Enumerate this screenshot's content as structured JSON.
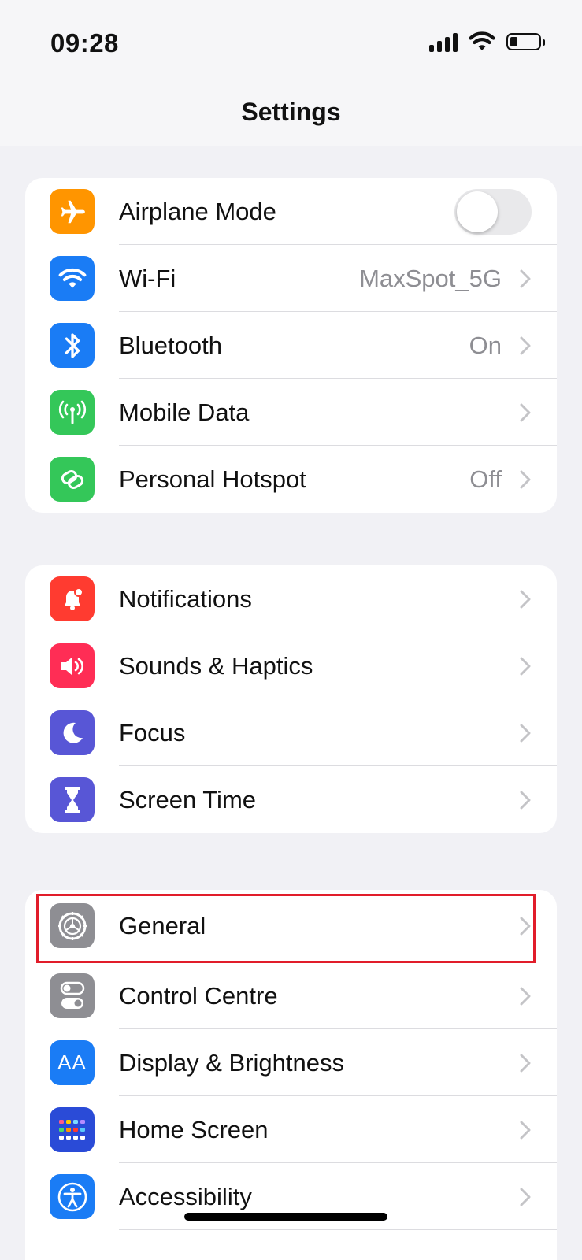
{
  "status_bar": {
    "time": "09:28"
  },
  "nav": {
    "title": "Settings"
  },
  "group1": [
    {
      "label": "Airplane Mode",
      "value": "",
      "icon": "airplane-icon",
      "color": "#ff9500"
    },
    {
      "label": "Wi-Fi",
      "value": "MaxSpot_5G",
      "icon": "wifi-icon",
      "color": "#1a7cf5"
    },
    {
      "label": "Bluetooth",
      "value": "On",
      "icon": "bluetooth-icon",
      "color": "#1a7cf5"
    },
    {
      "label": "Mobile Data",
      "value": "",
      "icon": "antenna-icon",
      "color": "#34c759"
    },
    {
      "label": "Personal Hotspot",
      "value": "Off",
      "icon": "hotspot-icon",
      "color": "#34c759"
    }
  ],
  "group2": [
    {
      "label": "Notifications",
      "icon": "bell-icon",
      "color": "#ff3b30"
    },
    {
      "label": "Sounds & Haptics",
      "icon": "speaker-icon",
      "color": "#ff2d55"
    },
    {
      "label": "Focus",
      "icon": "moon-icon",
      "color": "#5856d6"
    },
    {
      "label": "Screen Time",
      "icon": "hourglass-icon",
      "color": "#5856d6"
    }
  ],
  "group3": [
    {
      "label": "General",
      "icon": "gear-icon",
      "color": "#8e8e93"
    },
    {
      "label": "Control Centre",
      "icon": "switches-icon",
      "color": "#8e8e93"
    },
    {
      "label": "Display & Brightness",
      "icon": "text-size-icon",
      "color": "#1a7cf5",
      "glyph": "AA"
    },
    {
      "label": "Home Screen",
      "icon": "home-grid-icon",
      "color": "#2a4bd7"
    },
    {
      "label": "Accessibility",
      "icon": "accessibility-icon",
      "color": "#1a7cf5"
    }
  ],
  "toggles": {
    "airplane_mode_on": false
  },
  "highlight": {
    "color": "#e11d2a"
  }
}
